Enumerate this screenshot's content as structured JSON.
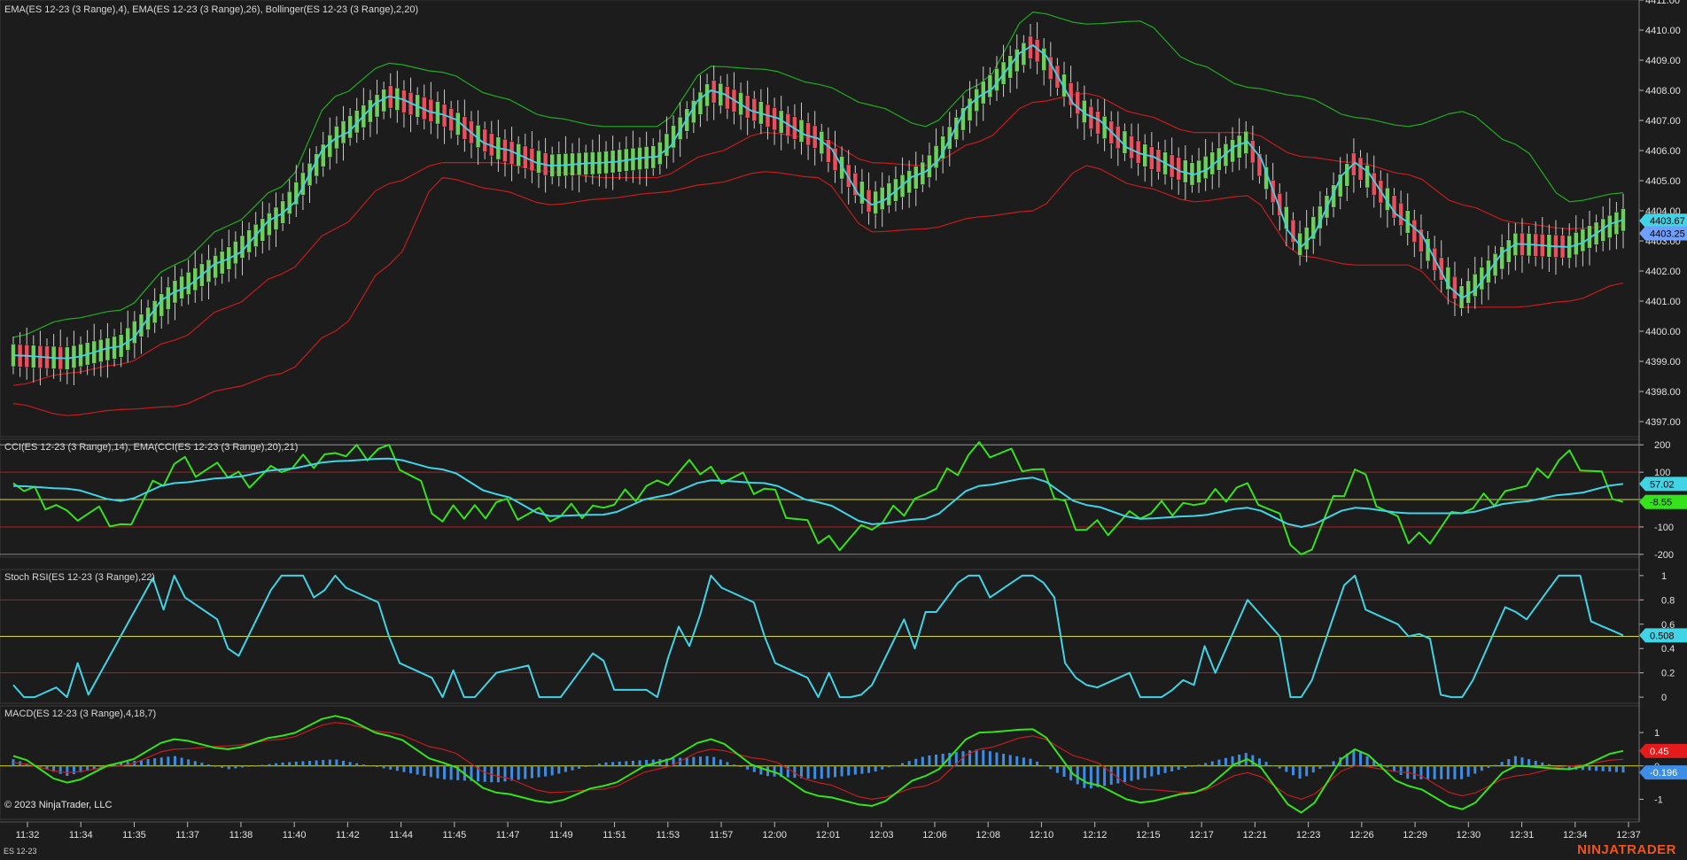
{
  "panels": {
    "price": {
      "label": "EMA(ES 12-23 (3 Range),4), EMA(ES 12-23 (3 Range),26), Bollinger(ES 12-23 (3 Range),2,20)",
      "y_ticks": [
        "4397.00",
        "4398.00",
        "4399.00",
        "4400.00",
        "4401.00",
        "4402.00",
        "4403.00",
        "4404.00",
        "4405.00",
        "4406.00",
        "4407.00",
        "4408.00",
        "4409.00",
        "4410.00",
        "4411.00"
      ],
      "tag_fast": "4403.67",
      "tag_last": "4403.25"
    },
    "cci": {
      "label": "CCI(ES 12-23 (3 Range),14), EMA(CCI(ES 12-23 (3 Range),20),21)",
      "y_ticks": [
        "200",
        "100",
        "0",
        "-100",
        "-200"
      ],
      "tag_ema": "57.02",
      "tag_cci": "-8.55"
    },
    "stoch": {
      "label": "Stoch RSI(ES 12-23 (3 Range),22)",
      "y_ticks": [
        "1",
        "0.8",
        "0.6",
        "0.4",
        "0.2",
        "0"
      ],
      "tag": "0.508"
    },
    "macd": {
      "label": "MACD(ES 12-23 (3 Range),4,18,7)",
      "y_ticks": [
        "1",
        "0",
        "-1"
      ],
      "tag_avg": "0.45",
      "tag_diff": "-0.196"
    }
  },
  "time_labels": [
    "11:32",
    "11:34",
    "11:35",
    "11:37",
    "11:38",
    "11:40",
    "11:42",
    "11:44",
    "11:45",
    "11:47",
    "11:49",
    "11:51",
    "11:53",
    "11:57",
    "12:00",
    "12:01",
    "12:03",
    "12:06",
    "12:08",
    "12:10",
    "12:12",
    "12:15",
    "12:17",
    "12:21",
    "12:23",
    "12:26",
    "12:29",
    "12:30",
    "12:31",
    "12:34",
    "12:37"
  ],
  "copyright": "© 2023 NinjaTrader, LLC",
  "instrument": "ES 12-23",
  "logo": "NINJATRADER",
  "colors": {
    "background": "#1c1c1c",
    "up_candle": "#6fcf5e",
    "down_candle": "#ea4f5d",
    "ema_fast": "#3fd4e6",
    "ema_slow": "#c61c1c",
    "bollinger": "#1fae1f",
    "cci": "#34e31a",
    "level_yellow": "#d7d72e",
    "level_red": "#b81d1d",
    "histogram": "#3d8de6"
  },
  "chart_data": [
    {
      "type": "line",
      "title": "EMA(ES 12-23 (3 Range),4), EMA(ES 12-23 (3 Range),26), Bollinger(ES 12-23 (3 Range),2,20)",
      "x": [
        "11:32",
        "11:34",
        "11:35",
        "11:37",
        "11:38",
        "11:40",
        "11:42",
        "11:44",
        "11:45",
        "11:47",
        "11:49",
        "11:51",
        "11:53",
        "11:57",
        "12:00",
        "12:01",
        "12:03",
        "12:06",
        "12:08",
        "12:10",
        "12:12",
        "12:15",
        "12:17",
        "12:21",
        "12:23",
        "12:26",
        "12:29",
        "12:30",
        "12:31",
        "12:34",
        "12:37"
      ],
      "ylim": [
        4396.5,
        4411.0
      ],
      "series": [
        {
          "name": "EMA(ES 12-23 (3 Range),4)",
          "values": [
            4399.2,
            4399.1,
            4399.5,
            4401.3,
            4402.4,
            4403.9,
            4406.4,
            4407.8,
            4407.2,
            4406.1,
            4405.5,
            4405.6,
            4405.8,
            4408.0,
            4407.2,
            4406.4,
            4404.2,
            4405.3,
            4407.8,
            4409.5,
            4407.2,
            4405.9,
            4405.2,
            4406.3,
            4402.8,
            4405.6,
            4403.6,
            4401.1,
            4402.9,
            4402.8,
            4403.7
          ]
        },
        {
          "name": "EMA(ES 12-23 (3 Range),26)",
          "values": [
            4398.2,
            4398.6,
            4398.9,
            4399.7,
            4400.8,
            4401.9,
            4403.4,
            4404.9,
            4405.6,
            4405.6,
            4405.3,
            4405.1,
            4405.1,
            4405.9,
            4406.6,
            4406.4,
            4405.6,
            4405.5,
            4406.3,
            4407.6,
            4407.9,
            4407.2,
            4406.6,
            4406.6,
            4405.8,
            4405.6,
            4405.2,
            4404.2,
            4403.6,
            4403.4,
            4403.5
          ]
        },
        {
          "name": "Bollinger upper",
          "values": [
            4399.8,
            4400.4,
            4400.7,
            4402.2,
            4403.5,
            4404.8,
            4407.8,
            4408.9,
            4408.6,
            4407.8,
            4407.1,
            4406.8,
            4406.8,
            4408.8,
            4408.7,
            4408.2,
            4407.5,
            4406.8,
            4408.2,
            4410.6,
            4410.2,
            4410.3,
            4408.9,
            4408.1,
            4407.8,
            4407.1,
            4406.8,
            4407.3,
            4406.2,
            4404.3,
            4404.6
          ]
        },
        {
          "name": "Bollinger lower",
          "values": [
            4397.6,
            4397.2,
            4397.4,
            4397.5,
            4398.1,
            4398.6,
            4400.0,
            4402.2,
            4405.1,
            4404.7,
            4404.2,
            4404.4,
            4404.6,
            4404.9,
            4405.3,
            4405.1,
            4403.3,
            4403.4,
            4403.8,
            4404.0,
            4405.5,
            4404.8,
            4404.3,
            4404.5,
            4402.5,
            4402.2,
            4402.2,
            4400.8,
            4400.8,
            4401.0,
            4401.6
          ]
        }
      ]
    },
    {
      "type": "line",
      "title": "CCI(ES 12-23 (3 Range),14), EMA(CCI(ES 12-23 (3 Range),20),21)",
      "x": [
        "11:32",
        "11:34",
        "11:35",
        "11:37",
        "11:38",
        "11:40",
        "11:42",
        "11:44",
        "11:45",
        "11:47",
        "11:49",
        "11:51",
        "11:53",
        "11:57",
        "12:00",
        "12:01",
        "12:03",
        "12:06",
        "12:08",
        "12:10",
        "12:12",
        "12:15",
        "12:17",
        "12:21",
        "12:23",
        "12:26",
        "12:29",
        "12:30",
        "12:31",
        "12:34",
        "12:37"
      ],
      "ylim": [
        -210,
        220
      ],
      "levels": [
        200,
        100,
        0,
        -100,
        -200
      ],
      "series": [
        {
          "name": "CCI(ES 12-23 (3 Range),14)",
          "values": [
            60,
            -40,
            -90,
            130,
            80,
            100,
            170,
            200,
            -80,
            -10,
            -80,
            -30,
            70,
            120,
            40,
            -160,
            -110,
            20,
            210,
            110,
            -110,
            -70,
            -20,
            60,
            -200,
            110,
            -160,
            -50,
            40,
            180,
            -8.55
          ]
        },
        {
          "name": "EMA(CCI(ES 12-23 (3 Range),20),21)",
          "values": [
            50,
            40,
            -5,
            60,
            80,
            110,
            140,
            150,
            110,
            20,
            -60,
            -55,
            10,
            70,
            60,
            -10,
            -90,
            -70,
            50,
            80,
            -20,
            -70,
            -60,
            -30,
            -100,
            -30,
            -50,
            -50,
            -10,
            20,
            57.02
          ]
        }
      ]
    },
    {
      "type": "line",
      "title": "Stoch RSI(ES 12-23 (3 Range),22)",
      "x": [
        "11:32",
        "11:34",
        "11:35",
        "11:37",
        "11:38",
        "11:40",
        "11:42",
        "11:44",
        "11:45",
        "11:47",
        "11:49",
        "11:51",
        "11:53",
        "11:57",
        "12:00",
        "12:01",
        "12:03",
        "12:06",
        "12:08",
        "12:10",
        "12:12",
        "12:15",
        "12:17",
        "12:21",
        "12:23",
        "12:26",
        "12:29",
        "12:30",
        "12:31",
        "12:34",
        "12:37"
      ],
      "ylim": [
        -0.05,
        1.05
      ],
      "levels": [
        0.8,
        0.5,
        0.2
      ],
      "series": [
        {
          "name": "Stoch RSI(ES 12-23 (3 Range),22)",
          "values": [
            0.1,
            0.0,
            0.5,
            1.0,
            0.4,
            1.0,
            1.0,
            0.5,
            0.0,
            0.2,
            0.0,
            0.3,
            0.0,
            1.0,
            0.5,
            0.0,
            0.1,
            0.7,
            1.0,
            1.0,
            0.1,
            0.0,
            0.1,
            0.8,
            0.0,
            1.0,
            0.5,
            0.0,
            0.7,
            1.0,
            0.508
          ]
        }
      ]
    },
    {
      "type": "line",
      "title": "MACD(ES 12-23 (3 Range),4,18,7)",
      "x": [
        "11:32",
        "11:34",
        "11:35",
        "11:37",
        "11:38",
        "11:40",
        "11:42",
        "11:44",
        "11:45",
        "11:47",
        "11:49",
        "11:51",
        "11:53",
        "11:57",
        "12:00",
        "12:01",
        "12:03",
        "12:06",
        "12:08",
        "12:10",
        "12:12",
        "12:15",
        "12:17",
        "12:21",
        "12:23",
        "12:26",
        "12:29",
        "12:30",
        "12:31",
        "12:34",
        "12:37"
      ],
      "ylim": [
        -1.6,
        1.8
      ],
      "series": [
        {
          "name": "MACD",
          "values": [
            0.3,
            -0.5,
            0.1,
            0.8,
            0.5,
            0.9,
            1.5,
            0.9,
            0.1,
            -0.8,
            -1.1,
            -0.6,
            0.1,
            0.8,
            -0.1,
            -0.9,
            -1.2,
            -0.3,
            1.0,
            1.1,
            -0.5,
            -1.1,
            -0.8,
            0.2,
            -1.4,
            0.5,
            -0.6,
            -1.3,
            0.0,
            -0.1,
            0.45
          ]
        },
        {
          "name": "Avg",
          "values": [
            0.1,
            -0.2,
            0.0,
            0.5,
            0.6,
            0.8,
            1.3,
            1.0,
            0.5,
            -0.3,
            -0.8,
            -0.7,
            -0.1,
            0.5,
            0.2,
            -0.5,
            -1.0,
            -0.6,
            0.5,
            0.9,
            0.2,
            -0.7,
            -0.8,
            -0.2,
            -1.0,
            0.0,
            -0.2,
            -0.9,
            -0.3,
            0.0,
            0.2
          ]
        },
        {
          "name": "Diff",
          "values": [
            0.2,
            -0.3,
            0.1,
            0.3,
            -0.1,
            0.1,
            0.2,
            -0.1,
            -0.4,
            -0.5,
            -0.3,
            0.1,
            0.2,
            0.3,
            -0.3,
            -0.4,
            -0.2,
            0.3,
            0.5,
            0.2,
            -0.7,
            -0.4,
            0.0,
            0.4,
            -0.4,
            0.5,
            -0.4,
            -0.4,
            0.3,
            -0.1,
            -0.196
          ]
        }
      ]
    }
  ]
}
